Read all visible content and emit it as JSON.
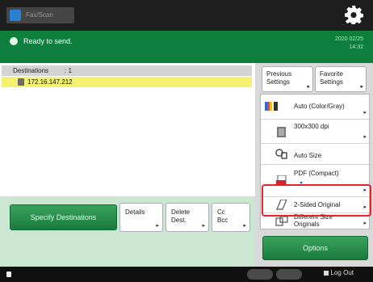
{
  "topbar": {
    "mode_label": "Fax/Scan",
    "settings_icon": "gear-icon"
  },
  "status": {
    "message": "Ready to send.",
    "date": "2020 02/25",
    "time": "14:32"
  },
  "destinations": {
    "header_label": "Destinations",
    "count": ": 1",
    "items": [
      {
        "address": "172.16.147.212"
      }
    ]
  },
  "buttons": {
    "specify": "Specify Destinations",
    "details": "Details",
    "delete": "Delete\nDest.",
    "cc": "Cc\nBcc",
    "previous_settings": "Previous\nSettings",
    "favorite_settings": "Favorite\nSettings",
    "options": "Options"
  },
  "settings": [
    {
      "label": "Auto (Color/Gray)",
      "icon": "color-mode-icon"
    },
    {
      "label": "300x300 dpi",
      "icon": "resolution-icon"
    },
    {
      "label": "Auto Size",
      "icon": "scan-size-icon"
    },
    {
      "label": "PDF (Compact)",
      "icon": "file-format-icon"
    },
    {
      "label": "2-Sided Original",
      "icon": "two-sided-icon"
    },
    {
      "label": "Different Size\nOriginals",
      "icon": "different-size-icon"
    }
  ],
  "footer": {
    "logout": "Log Out"
  },
  "colors": {
    "status_green": "#0e7f3d",
    "highlight_red": "#e8212b",
    "selected_row": "#f4f070"
  }
}
